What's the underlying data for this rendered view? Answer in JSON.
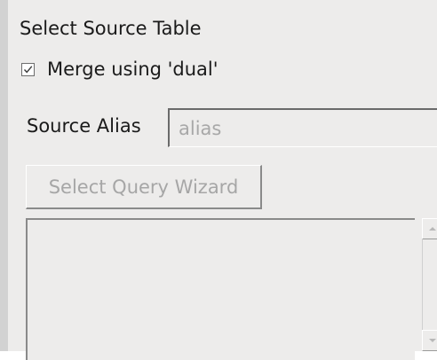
{
  "panel": {
    "title": "Select Source Table",
    "merge": {
      "label": "Merge using 'dual'",
      "checked": true
    },
    "source_alias": {
      "label": "Source Alias",
      "value": "",
      "placeholder": "alias"
    },
    "query_wizard": {
      "label": "Select Query Wizard",
      "enabled": false
    },
    "table_list": {
      "items": []
    }
  },
  "icons": {
    "checkbox": "checkmark-icon",
    "scroll_up": "scroll-up-arrow-icon",
    "scroll_down": "scroll-down-arrow-icon"
  }
}
